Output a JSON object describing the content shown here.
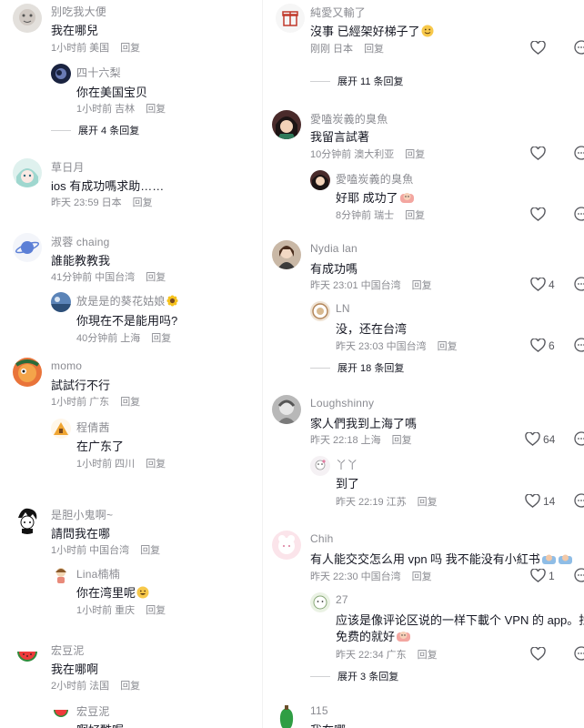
{
  "left_column": {
    "comments": [
      {
        "name": "别吃我大便",
        "text": "我在哪兒",
        "meta": "1小时前 美国",
        "reply": "回复"
      },
      {
        "name": "四十六梨",
        "text": "你在美国宝贝",
        "meta": "1小时前 吉林",
        "reply": "回复",
        "is_reply": true
      },
      {
        "expand": "展开 4 条回复"
      },
      {
        "name": "草日月",
        "text": "ios 有成功嗎求助……",
        "meta": "昨天 23:59 日本",
        "reply": "回复"
      },
      {
        "name": "淑蓉 chaing",
        "text": "誰能教教我",
        "meta": "41分钟前 中国台湾",
        "reply": "回复"
      },
      {
        "name": "放是是的葵花姑娘",
        "text": "你現在不是能用吗?",
        "meta": "40分钟前 上海",
        "reply": "回复",
        "is_reply": true
      },
      {
        "name": "momo",
        "text": "試試行不行",
        "meta": "1小时前 广东",
        "reply": "回复"
      },
      {
        "name": "程倩茜",
        "text": "在广东了",
        "meta": "1小时前 四川",
        "reply": "回复",
        "is_reply": true
      },
      {
        "name": "是胆小鬼啊~",
        "text": "請問我在哪",
        "meta": "1小时前 中国台湾",
        "reply": "回复"
      },
      {
        "name": "Lina楠楠",
        "text": "你在湾里呢",
        "meta": "1小时前 重庆",
        "reply": "回复",
        "is_reply": true
      },
      {
        "name": "宏豆泥",
        "text": "我在哪啊",
        "meta": "2小时前 法国",
        "reply": "回复"
      },
      {
        "name": "宏豆泥",
        "text": "啊好酷喔",
        "is_reply": true
      }
    ]
  },
  "right_column": {
    "comments": [
      {
        "name": "純愛又輸了",
        "text": "沒事 已經架好梯子了",
        "meta": "刚刚 日本",
        "reply": "回复"
      },
      {
        "expand": "展开 11 条回复"
      },
      {
        "name": "愛嗑炭義的臭魚",
        "text": "我留言試著",
        "meta": "10分钟前 澳大利亚",
        "reply": "回复"
      },
      {
        "name": "愛嗑炭義的臭魚",
        "text": "好耶 成功了",
        "meta": "8分钟前 瑞士",
        "reply": "回复",
        "is_reply": true
      },
      {
        "name": "Nydia lan",
        "text": "有成功嗎",
        "meta": "昨天 23:01 中国台湾",
        "reply": "回复",
        "likes": "4"
      },
      {
        "name": "LN",
        "text": "没，还在台湾",
        "meta": "昨天 23:03 中国台湾",
        "reply": "回复",
        "likes": "6",
        "is_reply": true
      },
      {
        "expand": "展开 18 条回复"
      },
      {
        "name": "Loughshinny",
        "text": "家人們我到上海了嗎",
        "meta": "昨天 22:18 上海",
        "reply": "回复",
        "likes": "64"
      },
      {
        "name": "丫丫",
        "text": "到了",
        "meta": "昨天 22:19 江苏",
        "reply": "回复",
        "likes": "14",
        "is_reply": true
      },
      {
        "name": "Chih",
        "text": "有人能交交怎么用 vpn 吗 我不能没有小紅书",
        "meta": "昨天 22:30 中国台湾",
        "reply": "回复",
        "likes": "1"
      },
      {
        "name": "27",
        "text": "应该是像评论区说的一样下載个 VPN 的 app。找个",
        "text2": "免费的就好",
        "meta": "昨天 22:34 广东",
        "reply": "回复",
        "is_reply": true
      },
      {
        "expand": "展开 3 条回复"
      },
      {
        "name": "115",
        "text": "我在哪"
      }
    ]
  },
  "icons": {
    "like": "heart-outline-icon",
    "more": "more-horizontal-icon"
  },
  "colors": {
    "text": "#161823",
    "secondary": "#8a8b91",
    "divider": "#d0d1d3"
  }
}
